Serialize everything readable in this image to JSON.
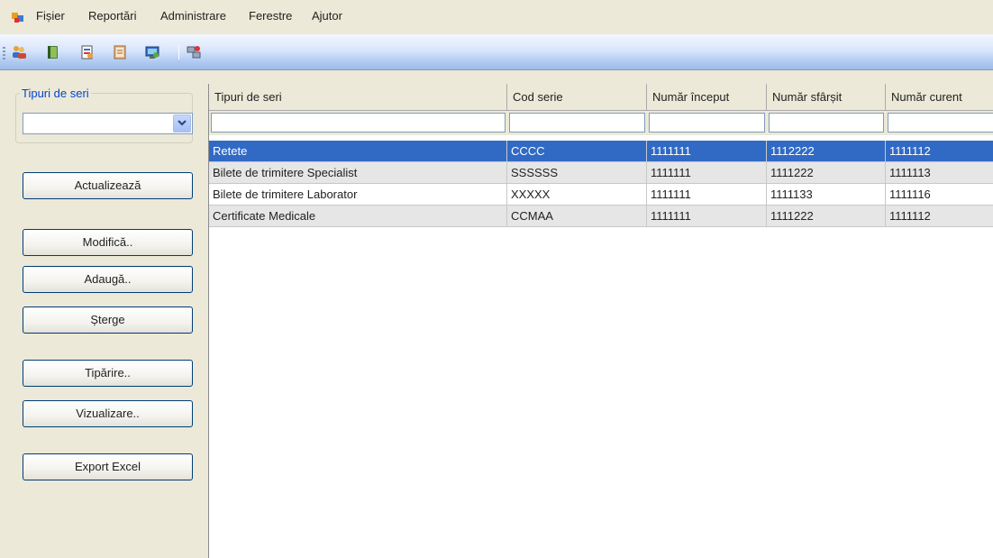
{
  "menu": {
    "items": [
      "Fișier",
      "Reportări",
      "Administrare",
      "Ferestre",
      "Ajutor"
    ]
  },
  "toolbar": {
    "icons": [
      "users-icon",
      "book-icon",
      "document-icon",
      "notebook-icon",
      "monitor-icon",
      "network-icon"
    ]
  },
  "left_panel": {
    "group_label": "Tipuri de seri",
    "combo_value": "",
    "buttons": {
      "refresh": "Actualizează",
      "modify": "Modifică..",
      "add": "Adaugă..",
      "delete": "Șterge",
      "print": "Tipărire..",
      "preview": "Vizualizare..",
      "export": "Export Excel"
    }
  },
  "grid": {
    "columns": [
      "Tipuri de seri",
      "Cod serie",
      "Număr început",
      "Număr sfârșit",
      "Număr curent"
    ],
    "rows": [
      [
        "Retete",
        "CCCC",
        "1111111",
        "1112222",
        "1111112"
      ],
      [
        "Bilete de trimitere Specialist",
        "SSSSSS",
        "1111111",
        "1111222",
        "1111113"
      ],
      [
        "Bilete de trimitere Laborator",
        "XXXXX",
        "1111111",
        "1111133",
        "1111116"
      ],
      [
        "Certificate Medicale",
        "CCMAA",
        "1111111",
        "1111222",
        "1111112"
      ]
    ],
    "selected_row": 0
  }
}
